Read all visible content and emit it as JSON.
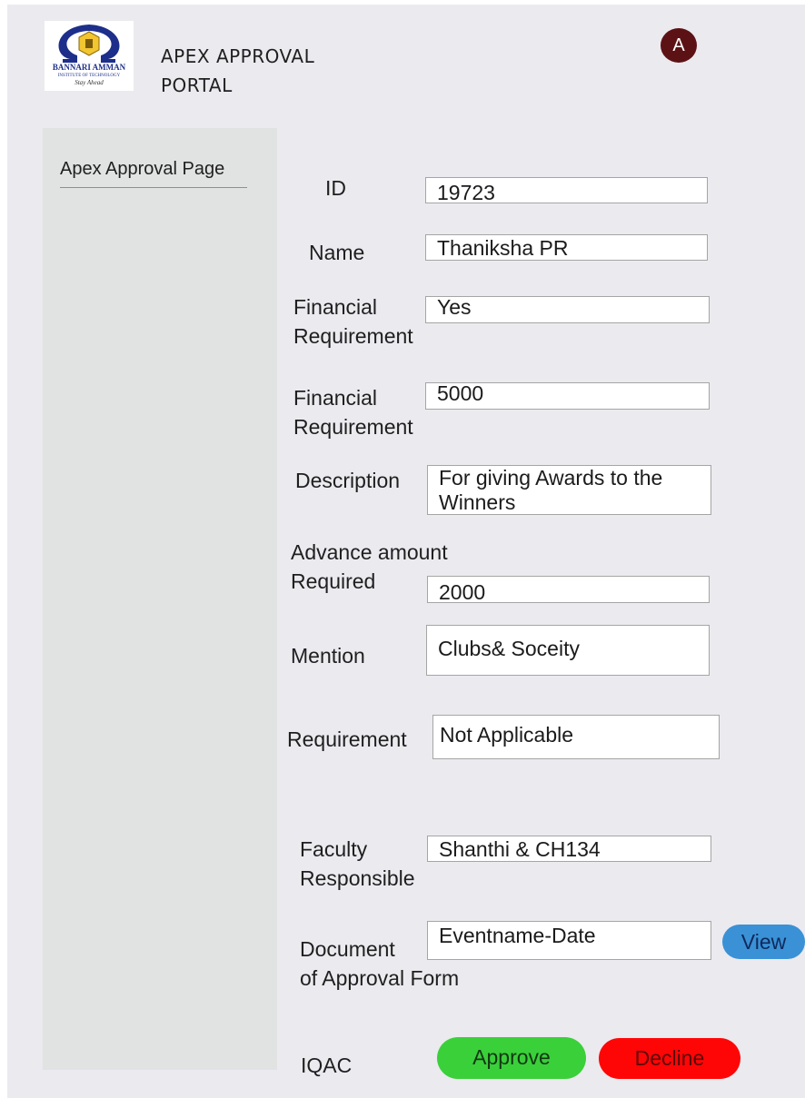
{
  "header": {
    "logo": {
      "icon": "institution-seal-icon",
      "lines": [
        "BANNARI AMMAN",
        "INSTITUTE OF TECHNOLOGY",
        "Stay Ahead"
      ]
    },
    "title_line1": "APEX APPROVAL",
    "title_line2": "PORTAL",
    "avatar_initial": "A",
    "avatar_color": "#5c1214"
  },
  "sidebar": {
    "items": [
      {
        "label": "Apex Approval Page"
      }
    ]
  },
  "form": {
    "id_label": "ID",
    "id_value": "19723",
    "name_label": "Name",
    "name_value": "Thaniksha PR",
    "fin_req_label_1": "Financial",
    "fin_req_label_2": "Requirement",
    "fin_req_value": "Yes",
    "fin_amt_label_1": "Financial",
    "fin_amt_label_2": "Requirement",
    "fin_amt_value": "5000",
    "description_label": "Description",
    "description_line1": "For giving Awards to the",
    "description_line2": "Winners",
    "advance_label_1": "Advance amount",
    "advance_label_2": "Required",
    "advance_value": "2000",
    "mention_label": "Mention",
    "mention_value": "Clubs& Soceity",
    "requirement_label": "Requirement",
    "requirement_value": "Not Applicable",
    "faculty_label_1": "Faculty",
    "faculty_label_2": "Responsible",
    "faculty_value": "Shanthi & CH134",
    "document_label_1": "Document",
    "document_label_2": "of Approval Form",
    "document_value": "Eventname-Date",
    "view_label": "View",
    "iqac_label": "IQAC",
    "approve_label": "Approve",
    "decline_label": "Decline"
  },
  "colors": {
    "background": "#ebeaef",
    "sidebar": "#e0e3e2",
    "view": "#3a91d6",
    "approve": "#3ad03a",
    "decline": "#ff0606"
  }
}
